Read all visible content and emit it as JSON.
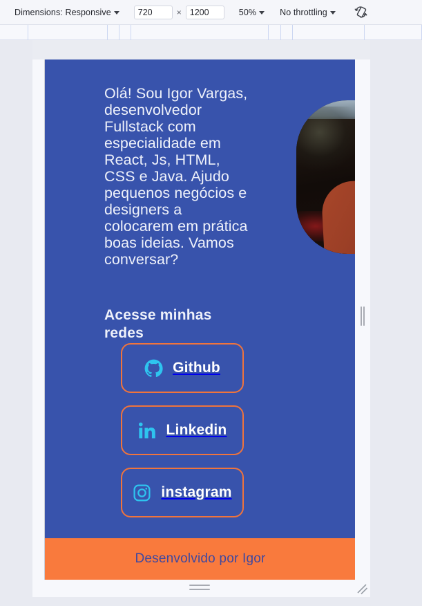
{
  "devtools_toolbar": {
    "dimensions_label": "Dimensions: Responsive",
    "width_value": "720",
    "height_value": "1200",
    "separator": "×",
    "zoom_label": "50%",
    "throttling_label": "No throttling",
    "rotate_icon": "rotate-device-icon",
    "width_placeholder": "width",
    "height_placeholder": "height"
  },
  "page": {
    "intro_text": "Olá! Sou Igor Vargas, desenvolvedor Fullstack com especialidade em React, Js, HTML, CSS e Java. Ajudo pequenos negócios e designers a colocarem em prática boas ideias. Vamos conversar?",
    "headline": "Acesse minhas redes",
    "portrait_alt": "portrait-photo",
    "social_buttons": [
      {
        "label": "Github",
        "icon": "github-icon"
      },
      {
        "label": "Linkedin",
        "icon": "linkedin-icon"
      },
      {
        "label": "instagram",
        "icon": "instagram-icon"
      }
    ],
    "footer_text": "Desenvolvido por Igor",
    "colors": {
      "background_blue": "#3853ac",
      "accent_orange": "#f97a3d",
      "button_border_orange": "#f0743c",
      "icon_cyan": "#2ec4ef",
      "text_white": "#eef1fa",
      "footer_text_blue": "#3f48a0"
    }
  }
}
